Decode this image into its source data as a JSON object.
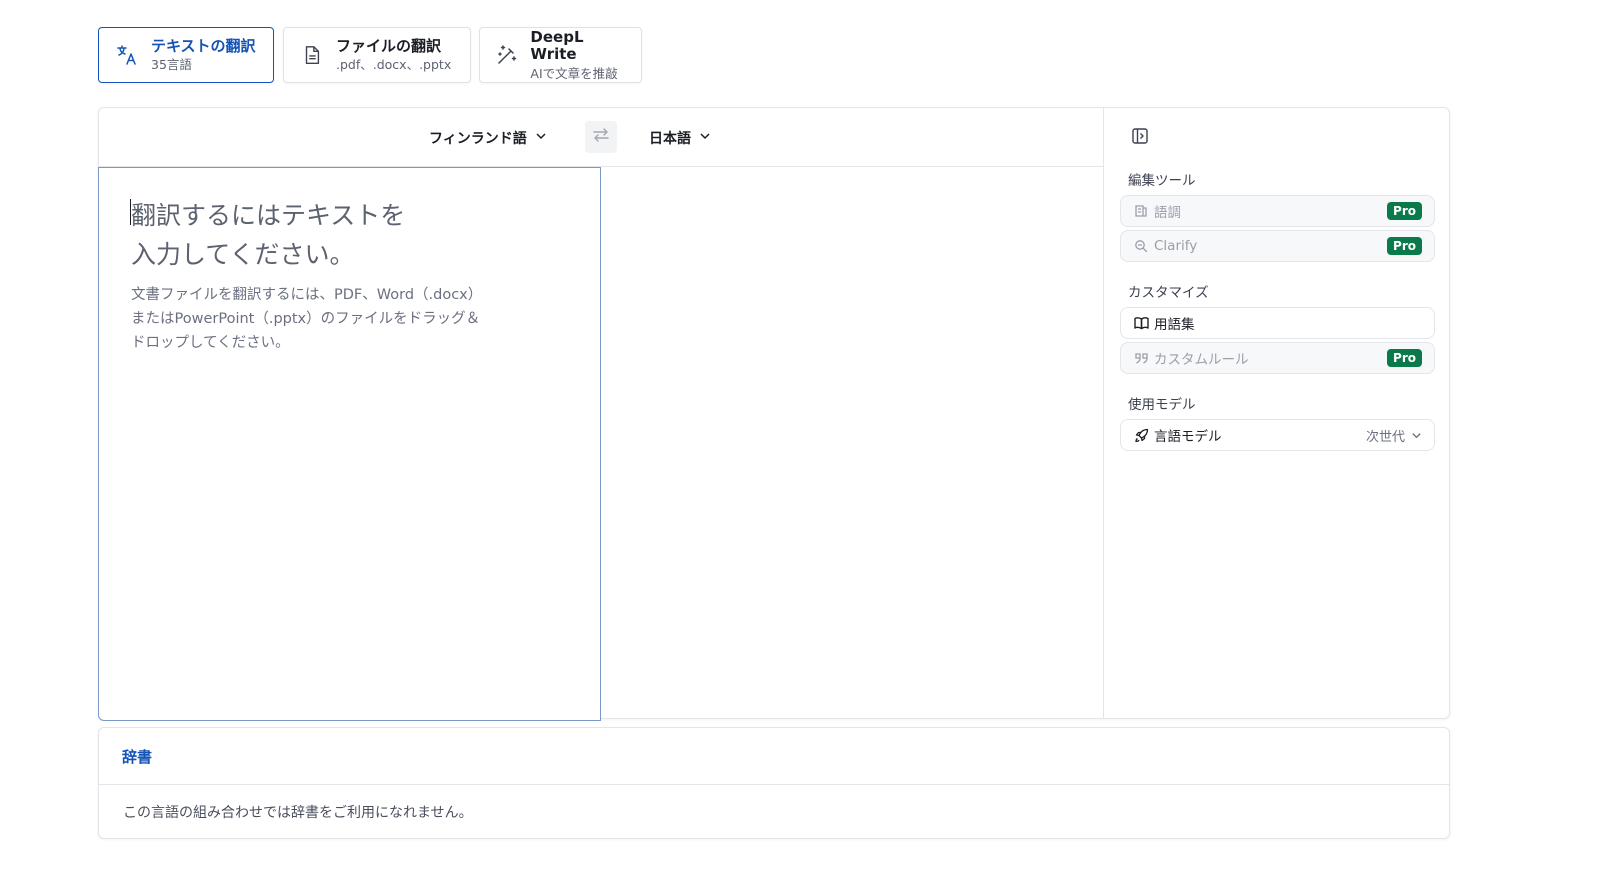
{
  "mode_tabs": [
    {
      "title": "テキストの翻訳",
      "subtitle": "35言語",
      "icon": "translate-icon"
    },
    {
      "title": "ファイルの翻訳",
      "subtitle": ".pdf、.docx、.pptx",
      "icon": "document-icon"
    },
    {
      "title": "DeepL Write",
      "subtitle": "AIで文章を推敲",
      "icon": "magic-pen-icon"
    }
  ],
  "translator": {
    "source_lang": "フィンランド語",
    "target_lang": "日本語",
    "source_placeholder": "翻訳するにはテキストを\n入力してください。",
    "source_hint": "文書ファイルを翻訳するには、PDF、Word（.docx）\nまたはPowerPoint（.pptx）のファイルをドラッグ＆\nドロップしてください。",
    "target_text": ""
  },
  "side_panel": {
    "editing_tools_label": "編集ツール",
    "tone_label": "語調",
    "clarify_label": "Clarify",
    "customize_label": "カスタマイズ",
    "glossary_label": "用語集",
    "custom_rules_label": "カスタムルール",
    "model_section_label": "使用モデル",
    "model_label": "言語モデル",
    "model_value": "次世代",
    "pro_badge": "Pro"
  },
  "dictionary": {
    "title": "辞書",
    "message": "この言語の組み合わせでは辞書をご利用になれません。"
  },
  "colors": {
    "accent": "#1553b6",
    "pro_badge": "#0a7a4b",
    "border": "#e3e5ea"
  }
}
